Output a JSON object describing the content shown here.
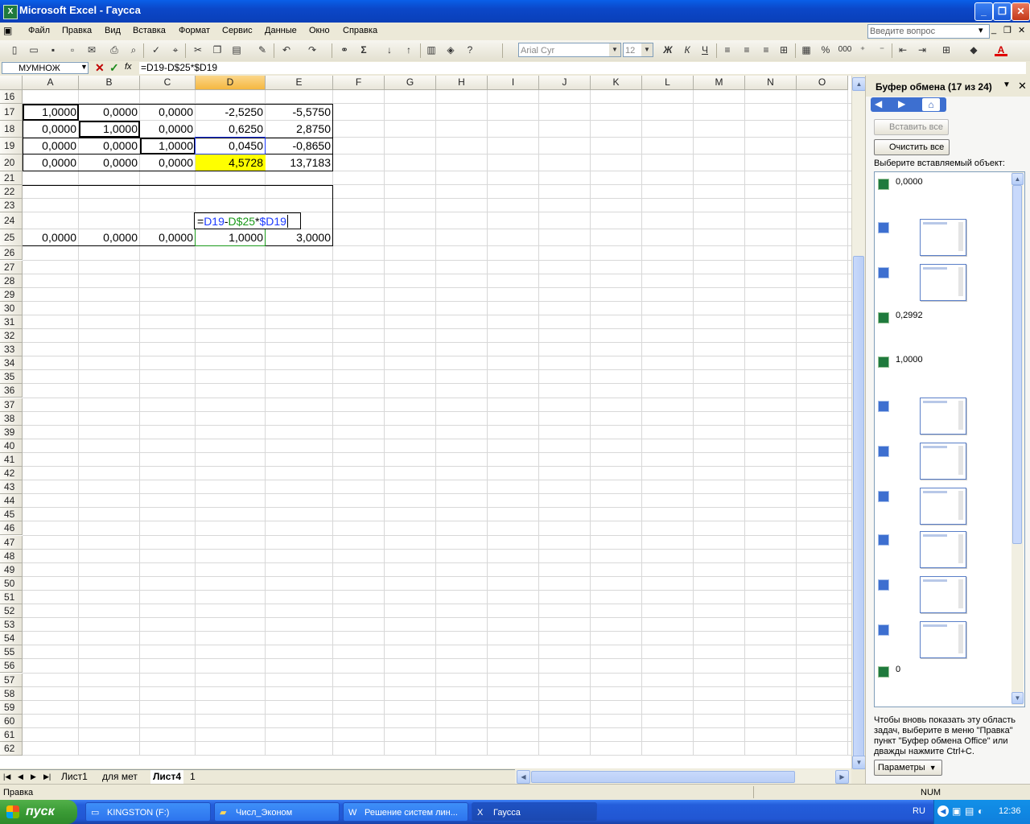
{
  "window": {
    "title": "Microsoft Excel - Гаусса",
    "app_icon": "excel-icon"
  },
  "menu": {
    "items": [
      "Файл",
      "Правка",
      "Вид",
      "Вставка",
      "Формат",
      "Сервис",
      "Данные",
      "Окно",
      "Справка"
    ],
    "ask_placeholder": "Введите вопрос"
  },
  "toolbar": {
    "font_name": "Arial Cyr",
    "font_size": "12",
    "bold": "Ж",
    "italic": "К",
    "underline": "Ч",
    "percent": "%",
    "thousands": "000"
  },
  "formula_bar": {
    "name_box": "МУМНОЖ",
    "fx": "fx",
    "formula": "=D19-D$25*$D19"
  },
  "sheet": {
    "columns": [
      "A",
      "B",
      "C",
      "D",
      "E",
      "F",
      "G",
      "H",
      "I",
      "J",
      "K",
      "L",
      "M",
      "N",
      "O"
    ],
    "selected_column": "D",
    "first_row": 16,
    "last_row": 62,
    "rows": {
      "r17": [
        "1,0000",
        "0,0000",
        "0,0000",
        "-2,5250",
        "-5,5750"
      ],
      "r18": [
        "0,0000",
        "1,0000",
        "0,0000",
        "0,6250",
        "2,8750"
      ],
      "r19": [
        "0,0000",
        "0,0000",
        "1,0000",
        "0,0450",
        "-0,8650"
      ],
      "r20": [
        "0,0000",
        "0,0000",
        "0,0000",
        "4,5728",
        "13,7183"
      ],
      "r25": [
        "0,0000",
        "0,0000",
        "0,0000",
        "1,0000",
        "3,0000"
      ]
    },
    "edit_cell": {
      "ref": "D24",
      "parts": [
        "=",
        "D19",
        "-",
        "D$25",
        "*",
        "$D19"
      ]
    },
    "highlight_color": "#ffff00"
  },
  "sheet_tabs": [
    "Лист1",
    "для мет",
    "Лист4",
    "1"
  ],
  "active_tab": "Лист4",
  "task_pane": {
    "title": "Буфер обмена (17 из 24)",
    "paste_all": "Вставить все",
    "clear_all": "Очистить все",
    "prompt": "Выберите вставляемый объект:",
    "items": [
      {
        "type": "text",
        "label": "0,0000"
      },
      {
        "type": "image"
      },
      {
        "type": "image"
      },
      {
        "type": "text",
        "label": "0,2992"
      },
      {
        "type": "text",
        "label": "1,0000"
      },
      {
        "type": "image"
      },
      {
        "type": "image"
      },
      {
        "type": "image"
      },
      {
        "type": "image"
      },
      {
        "type": "image"
      },
      {
        "type": "image"
      },
      {
        "type": "text",
        "label": "0"
      }
    ],
    "hint": "Чтобы вновь показать эту область задач, выберите в меню \"Правка\" пункт \"Буфер обмена Office\" или дважды нажмите Ctrl+C.",
    "options": "Параметры"
  },
  "status_bar": {
    "mode": "Правка",
    "num": "NUM"
  },
  "taskbar": {
    "start": "пуск",
    "tasks": [
      "KINGSTON (F:)",
      "Числ_Эконом",
      "Решение систем лин...",
      "Гаусса"
    ],
    "lang": "RU",
    "clock": "12:36"
  }
}
